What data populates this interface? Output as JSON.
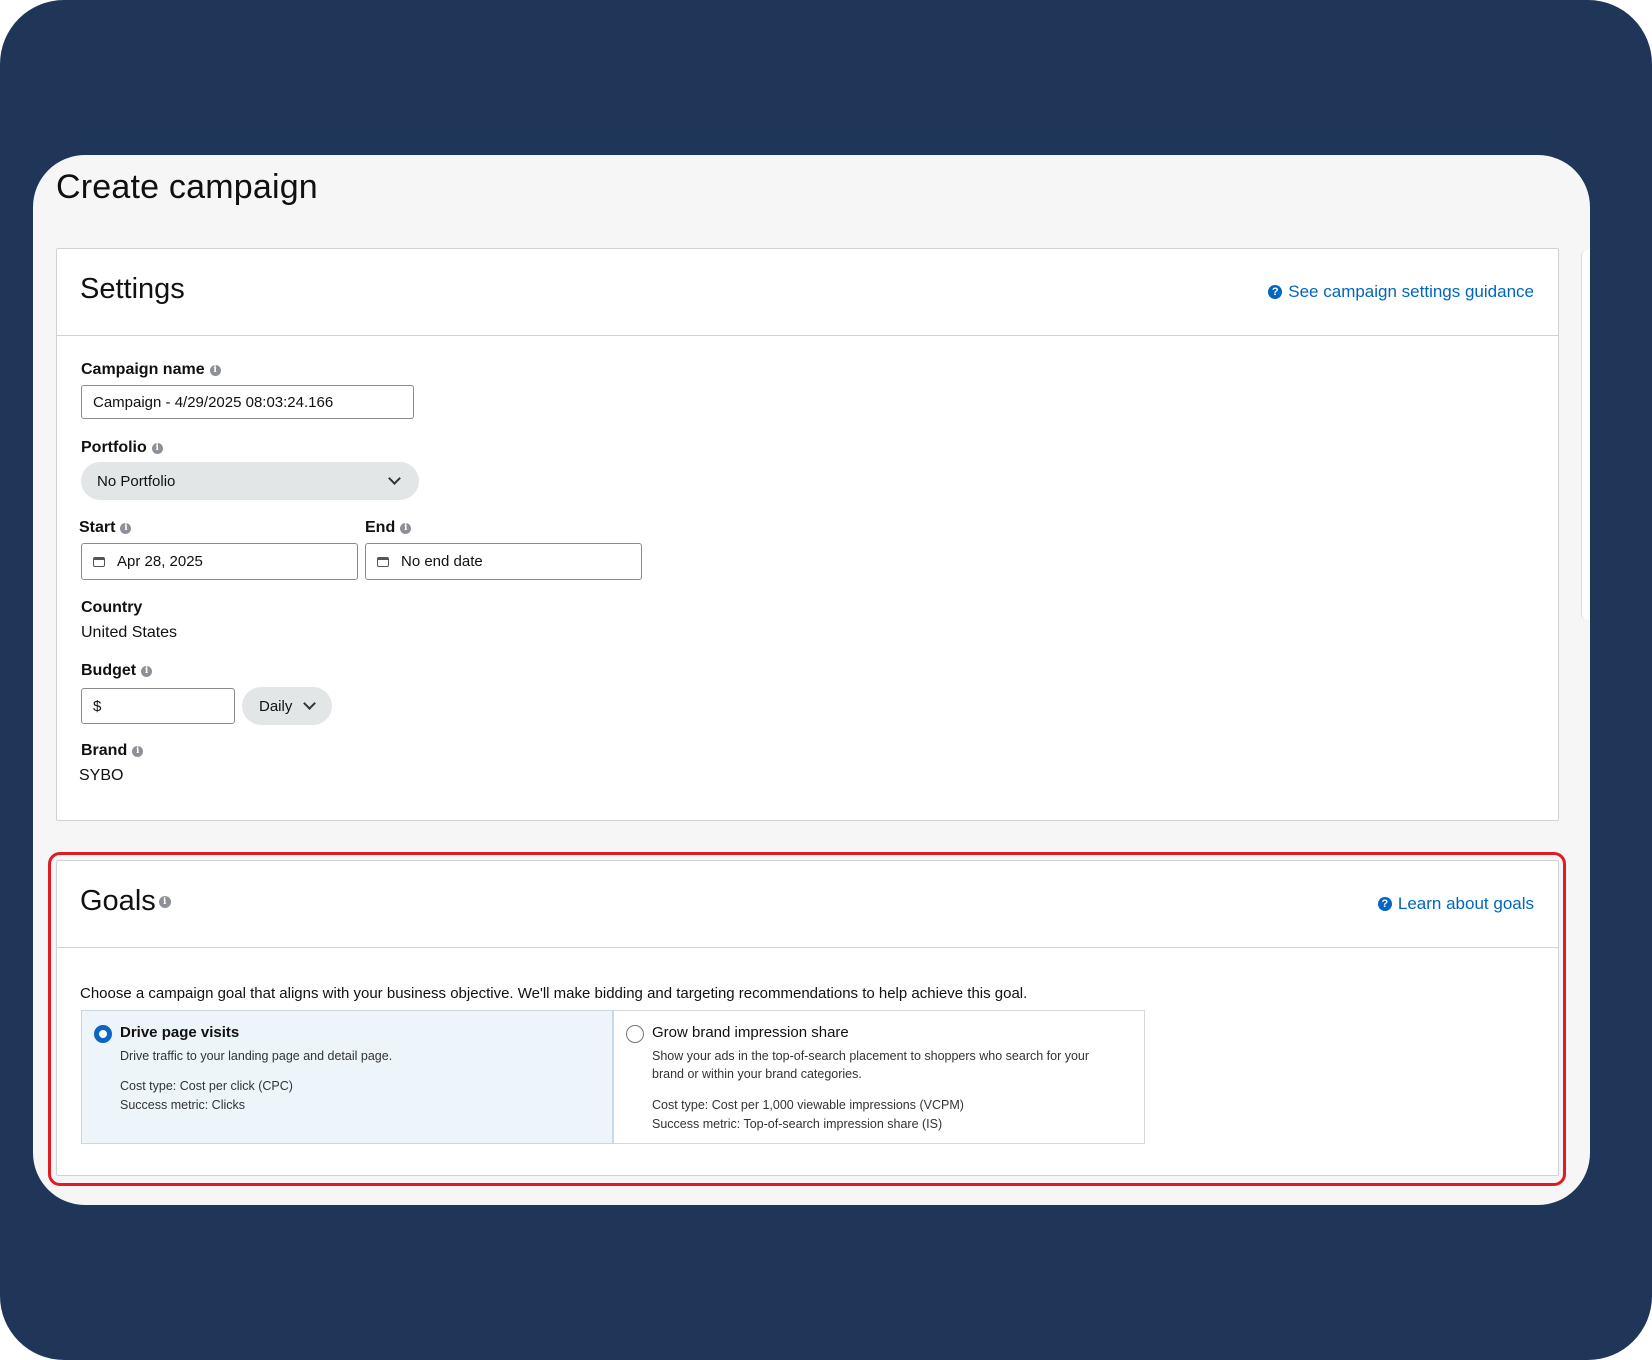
{
  "page": {
    "title": "Create campaign"
  },
  "settings": {
    "title": "Settings",
    "guidance_link": "See campaign settings guidance",
    "campaign_name": {
      "label": "Campaign name",
      "value": "Campaign - 4/29/2025 08:03:24.166"
    },
    "portfolio": {
      "label": "Portfolio",
      "value": "No Portfolio"
    },
    "start": {
      "label": "Start",
      "value": "Apr 28, 2025"
    },
    "end": {
      "label": "End",
      "value": "No end date"
    },
    "country": {
      "label": "Country",
      "value": "United States"
    },
    "budget": {
      "label": "Budget",
      "currency_prefix": "$",
      "period": "Daily"
    },
    "brand": {
      "label": "Brand",
      "value": "SYBO"
    }
  },
  "goals": {
    "title": "Goals",
    "learn_link": "Learn about goals",
    "description": "Choose a campaign goal that aligns with your business objective. We'll make bidding and targeting recommendations to help achieve this goal.",
    "options": [
      {
        "title": "Drive page visits",
        "subtitle": "Drive traffic to your landing page and detail page.",
        "cost_type": "Cost type: Cost per click (CPC)",
        "metric": "Success metric: Clicks",
        "selected": true
      },
      {
        "title": "Grow brand impression share",
        "subtitle_line1": "Show your ads in the top-of-search placement to shoppers who search for your",
        "subtitle_line2": "brand or within your brand categories.",
        "cost_type": "Cost type: Cost per 1,000 viewable impressions (VCPM)",
        "metric": "Success metric: Top-of-search impression share (IS)",
        "selected": false
      }
    ]
  },
  "colors": {
    "frame_bg": "#1f3658",
    "link": "#0066c0",
    "highlight": "#e01b24",
    "selected_option_bg": "#edf4fa"
  }
}
